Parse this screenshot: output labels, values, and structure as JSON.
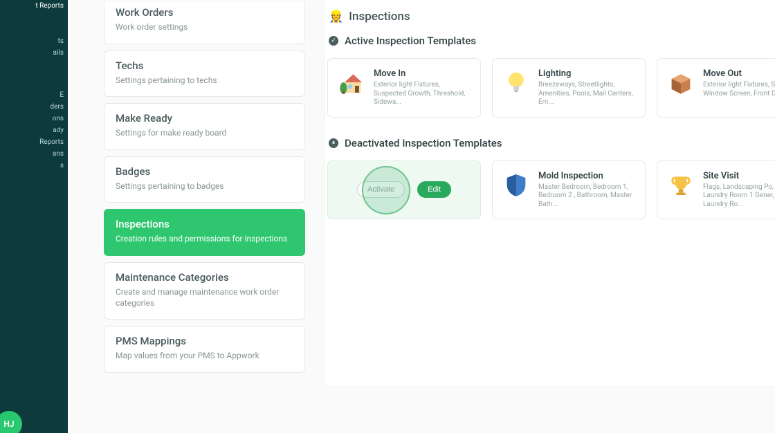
{
  "sidebar": {
    "items": [
      {
        "label": "t Reports"
      },
      {
        "label": "ts"
      },
      {
        "label": "ails"
      },
      {
        "label": "E"
      },
      {
        "label": "ders"
      },
      {
        "label": "ons"
      },
      {
        "label": "ady"
      },
      {
        "label": "Reports"
      },
      {
        "label": "ans"
      },
      {
        "label": "s"
      }
    ],
    "avatar": "HJ"
  },
  "settings": [
    {
      "title": "Work Orders",
      "desc": "Work order settings"
    },
    {
      "title": "Techs",
      "desc": "Settings pertaining to techs"
    },
    {
      "title": "Make Ready",
      "desc": "Settings for make ready board"
    },
    {
      "title": "Badges",
      "desc": "Settings pertaining to badges"
    },
    {
      "title": "Inspections",
      "desc": "Creation rules and permissions for inspections",
      "active": true
    },
    {
      "title": "Maintenance Categories",
      "desc": "Create and manage maintenance work order categories"
    },
    {
      "title": "PMS Mappings",
      "desc": "Map values from your PMS to Appwork"
    }
  ],
  "main": {
    "title": "Inspections",
    "active_header": "Active Inspection Templates",
    "deact_header": "Deactivated Inspection Templates",
    "active_cards": [
      {
        "title": "Move In",
        "desc": "Exterior light Fixtures, Suspected Growth, Threshold, Sidewa...",
        "icon": "house-icon"
      },
      {
        "title": "Lighting",
        "desc": "Breezeways, Streetlights, Amenities, Pools, Mail Centers, Em...",
        "icon": "bulb-icon"
      },
      {
        "title": "Move Out",
        "desc": "Exterior light Fixtures, Stairs, Window Screen, Front Door,...",
        "icon": "box-icon"
      }
    ],
    "deact_cards": [
      {
        "hover": true,
        "activate_label": "Activate",
        "edit_label": "Edit"
      },
      {
        "title": "Mold Inspection",
        "desc": "Master Bedroom, Bedroom 1, Bedroom 2 , Bathroom, Master Bath...",
        "icon": "shield-icon"
      },
      {
        "title": "Site Visit",
        "desc": "Flags, Landscaping Po, Laundry Room 1 Gener, Laundry Ro...",
        "icon": "trophy-icon"
      }
    ]
  }
}
